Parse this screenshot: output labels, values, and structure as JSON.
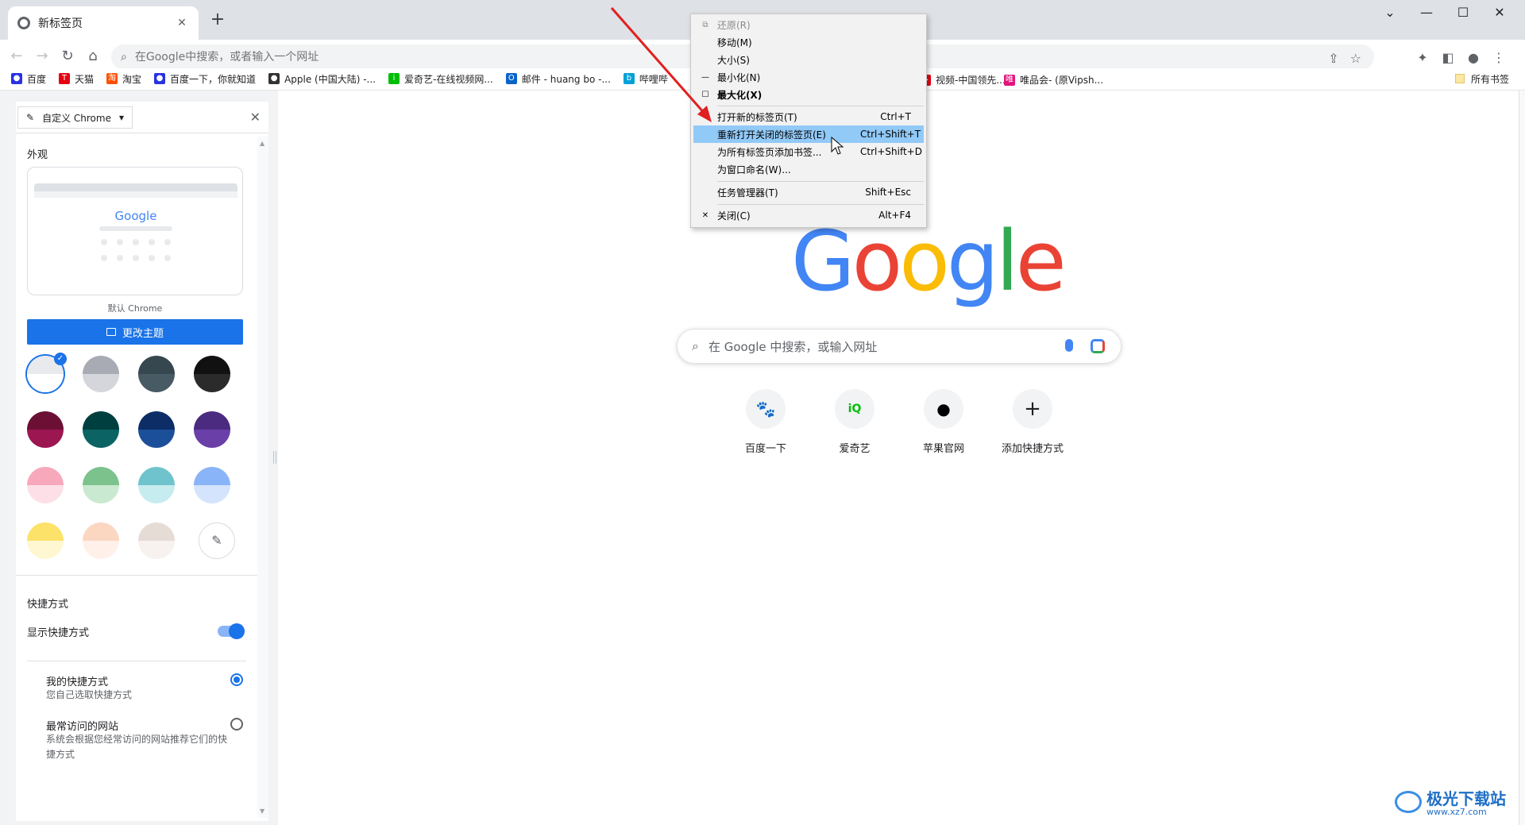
{
  "tab": {
    "title": "新标签页",
    "close": "✕"
  },
  "newtab": "+",
  "window_controls": [
    "⌄",
    "—",
    "☐",
    "✕"
  ],
  "toolbar": {
    "back": "←",
    "forward": "→",
    "reload": "↻",
    "home": "⌂"
  },
  "omnibox": {
    "placeholder": "在Google中搜索，或者输入一个网址"
  },
  "bookmarks": [
    {
      "label": "百度",
      "icon": "baidu-icon",
      "color": "#2932e1",
      "glyph": "●"
    },
    {
      "label": "天猫",
      "icon": "tmall-icon",
      "color": "#e50012",
      "glyph": "T"
    },
    {
      "label": "淘宝",
      "icon": "taobao-icon",
      "color": "#ff5000",
      "glyph": "淘"
    },
    {
      "label": "百度一下，你就知道",
      "icon": "baidu-icon",
      "color": "#2932e1",
      "glyph": "●"
    },
    {
      "label": "Apple (中国大陆) -...",
      "icon": "apple-icon",
      "color": "#333333",
      "glyph": "●"
    },
    {
      "label": "爱奇艺-在线视频网...",
      "icon": "iqiyi-icon",
      "color": "#00be06",
      "glyph": "i"
    },
    {
      "label": "邮件 - huang bo -...",
      "icon": "outlook-icon",
      "color": "#0a64c8",
      "glyph": "O"
    },
    {
      "label": "哔哩哔",
      "icon": "bilibili-icon",
      "color": "#00a1d6",
      "glyph": "b"
    }
  ],
  "bookmarks_right": [
    {
      "label": "视频-中国领先...",
      "icon": "video-icon",
      "color": "#e50012",
      "glyph": "▶"
    },
    {
      "label": "唯品会- (原Vipsh...",
      "icon": "vip-icon",
      "color": "#e1157b",
      "glyph": "唯"
    }
  ],
  "all_bookmarks": "所有书签",
  "side_panel": {
    "dropdown_label": "自定义 Chrome",
    "close": "✕",
    "appearance_title": "外观",
    "preview_logo": "Google",
    "theme_name": "默认 Chrome",
    "change_theme": "更改主题",
    "swatches": [
      {
        "name": "default",
        "top": "#e8eaed",
        "bottom": "#ffffff",
        "selected": true
      },
      {
        "name": "grey",
        "top": "#a8abb4",
        "bottom": "#d4d6dc"
      },
      {
        "name": "slate",
        "top": "#37474f",
        "bottom": "#485a63"
      },
      {
        "name": "black",
        "top": "#111111",
        "bottom": "#2b2b2b"
      },
      {
        "name": "wine",
        "top": "#6b0f34",
        "bottom": "#9c1652"
      },
      {
        "name": "teal",
        "top": "#003f3f",
        "bottom": "#0b6363"
      },
      {
        "name": "navy",
        "top": "#0d2d67",
        "bottom": "#1c4f99"
      },
      {
        "name": "purple",
        "top": "#4b2b7f",
        "bottom": "#6a3fa8"
      },
      {
        "name": "pink",
        "top": "#f7a8ba",
        "bottom": "#fde0e7"
      },
      {
        "name": "green",
        "top": "#7cc28d",
        "bottom": "#c9e9d0"
      },
      {
        "name": "aqua",
        "top": "#6fc3cc",
        "bottom": "#c6ecef"
      },
      {
        "name": "blue",
        "top": "#8ab4f8",
        "bottom": "#d4e4fc"
      },
      {
        "name": "yellow",
        "top": "#fde269",
        "bottom": "#fff7d1"
      },
      {
        "name": "peach",
        "top": "#fbd6c1",
        "bottom": "#fff1ea"
      },
      {
        "name": "beige",
        "top": "#e6dcd6",
        "bottom": "#f7f2ef"
      }
    ],
    "picker_icon": "✎",
    "shortcuts_title": "快捷方式",
    "show_shortcuts": "显示快捷方式",
    "show_shortcuts_on": true,
    "opt_my": {
      "title": "我的快捷方式",
      "desc": "您自己选取快捷方式"
    },
    "opt_most": {
      "title": "最常访问的网站",
      "desc": "系统会根据您经常访问的网站推荐它们的快捷方式"
    }
  },
  "ntp": {
    "logo_letters": [
      "G",
      "o",
      "o",
      "g",
      "l",
      "e"
    ],
    "search_placeholder": "在 Google 中搜索，或输入网址",
    "shortcuts": [
      {
        "label": "百度一下",
        "icon": "baidu-paw-icon",
        "glyph": "🐾",
        "color": "#2932e1"
      },
      {
        "label": "爱奇艺",
        "icon": "iqiyi-icon",
        "glyph": "iQ",
        "color": "#00be06"
      },
      {
        "label": "苹果官网",
        "icon": "apple-icon",
        "glyph": "●",
        "color": "#000000"
      },
      {
        "label": "添加快捷方式",
        "icon": "plus-icon",
        "glyph": "+",
        "color": "#202124"
      }
    ]
  },
  "context_menu": {
    "items": [
      {
        "label": "还原(R)",
        "glyph": "⧉",
        "shortcut": "",
        "state": "disabled"
      },
      {
        "label": "移动(M)",
        "glyph": "",
        "shortcut": "",
        "state": "normal"
      },
      {
        "label": "大小(S)",
        "glyph": "",
        "shortcut": "",
        "state": "normal"
      },
      {
        "label": "最小化(N)",
        "glyph": "—",
        "shortcut": "",
        "state": "normal"
      },
      {
        "label": "最大化(X)",
        "glyph": "☐",
        "shortcut": "",
        "state": "bold"
      },
      {
        "label": "打开新的标签页(T)",
        "glyph": "",
        "shortcut": "Ctrl+T",
        "state": "normal"
      },
      {
        "label": "重新打开关闭的标签页(E)",
        "glyph": "",
        "shortcut": "Ctrl+Shift+T",
        "state": "highlight"
      },
      {
        "label": "为所有标签页添加书签...",
        "glyph": "",
        "shortcut": "Ctrl+Shift+D",
        "state": "normal"
      },
      {
        "label": "为窗口命名(W)...",
        "glyph": "",
        "shortcut": "",
        "state": "normal"
      },
      {
        "label": "任务管理器(T)",
        "glyph": "",
        "shortcut": "Shift+Esc",
        "state": "normal"
      },
      {
        "label": "关闭(C)",
        "glyph": "✕",
        "shortcut": "Alt+F4",
        "state": "normal"
      }
    ]
  },
  "watermark": {
    "line1": "极光下载站",
    "line2": "www.xz7.com"
  },
  "colors": {
    "accent": "#1a73e8",
    "arrow": "#e02020",
    "menu_highlight": "#91c9f7"
  }
}
